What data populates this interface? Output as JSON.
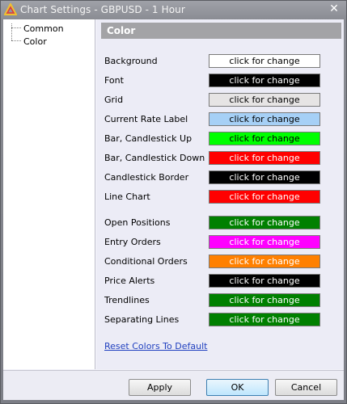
{
  "window": {
    "title": "Chart Settings - GBPUSD - 1 Hour",
    "close_glyph": "✕"
  },
  "tree": {
    "items": [
      {
        "label": "Common"
      },
      {
        "label": "Color"
      }
    ]
  },
  "panel": {
    "header": "Color",
    "rows": [
      {
        "label": "Background",
        "button": "click for change",
        "bg": "#ffffff",
        "fg": "#000000"
      },
      {
        "label": "Font",
        "button": "click for change",
        "bg": "#000000",
        "fg": "#ffffff"
      },
      {
        "label": "Grid",
        "button": "click for change",
        "bg": "#e6e4e4",
        "fg": "#000000"
      },
      {
        "label": "Current Rate Label",
        "button": "click for change",
        "bg": "#a6d0f6",
        "fg": "#000000"
      },
      {
        "label": "Bar, Candlestick Up",
        "button": "click for change",
        "bg": "#00ff00",
        "fg": "#000000"
      },
      {
        "label": "Bar, Candlestick Down",
        "button": "click for change",
        "bg": "#ff0000",
        "fg": "#ffffff"
      },
      {
        "label": "Candlestick Border",
        "button": "click for change",
        "bg": "#000000",
        "fg": "#ffffff"
      },
      {
        "label": "Line Chart",
        "button": "click for change",
        "bg": "#ff0000",
        "fg": "#ffffff"
      },
      {
        "label": "Open Positions",
        "button": "click for change",
        "bg": "#008000",
        "fg": "#ffffff"
      },
      {
        "label": "Entry Orders",
        "button": "click for change",
        "bg": "#ff00ff",
        "fg": "#ffffff"
      },
      {
        "label": "Conditional Orders",
        "button": "click for change",
        "bg": "#ff8000",
        "fg": "#ffffff"
      },
      {
        "label": "Price Alerts",
        "button": "click for change",
        "bg": "#000000",
        "fg": "#ffffff"
      },
      {
        "label": "Trendlines",
        "button": "click for change",
        "bg": "#008000",
        "fg": "#ffffff"
      },
      {
        "label": "Separating Lines",
        "button": "click for change",
        "bg": "#008000",
        "fg": "#ffffff"
      }
    ],
    "reset_link": "Reset Colors To Default"
  },
  "footer": {
    "apply": "Apply",
    "ok": "OK",
    "cancel": "Cancel"
  }
}
